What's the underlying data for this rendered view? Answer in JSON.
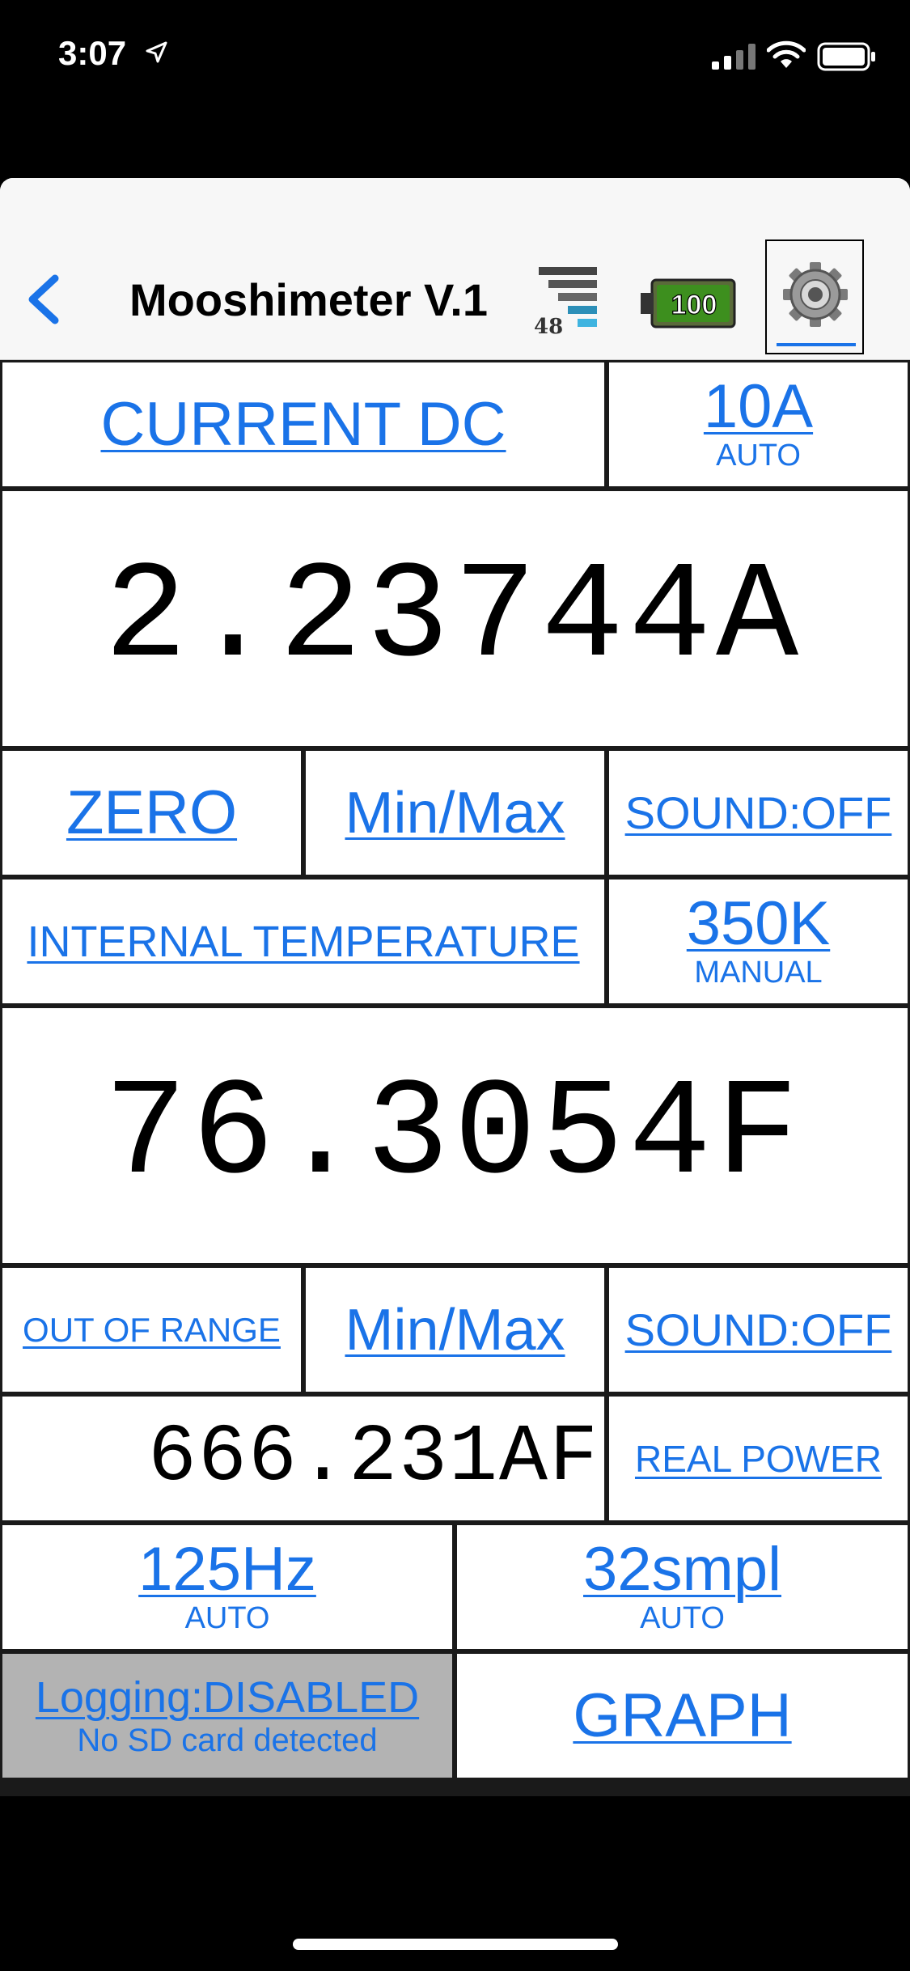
{
  "status_bar": {
    "time": "3:07",
    "icons": [
      "location-arrow-icon",
      "cellular-signal-icon",
      "wifi-icon",
      "battery-icon"
    ]
  },
  "navbar": {
    "title": "Mooshimeter V.1",
    "signal_value": "48",
    "battery_value": "100"
  },
  "channel1": {
    "mode": "CURRENT DC",
    "range": "10A",
    "range_mode": "AUTO",
    "reading": "2.23744A",
    "zero_label": "ZERO",
    "minmax_label": "Min/Max",
    "sound_label": "SOUND:OFF"
  },
  "channel2": {
    "mode": "INTERNAL TEMPERATURE",
    "range": "350K",
    "range_mode": "MANUAL",
    "reading": "76.3054F",
    "range_status": "OUT OF RANGE",
    "minmax_label": "Min/Max",
    "sound_label": "SOUND:OFF"
  },
  "math": {
    "reading": "666.231AF",
    "function": "REAL POWER"
  },
  "sampling": {
    "rate": "125Hz",
    "rate_mode": "AUTO",
    "depth": "32smpl",
    "depth_mode": "AUTO"
  },
  "logging": {
    "label": "Logging:DISABLED",
    "status": "No SD card detected"
  },
  "graph_label": "GRAPH",
  "colors": {
    "accent": "#1a73e8",
    "background": "#ffffff",
    "grid_lines": "#1a1a1a",
    "logging_disabled_bg": "#b3b3b3"
  }
}
